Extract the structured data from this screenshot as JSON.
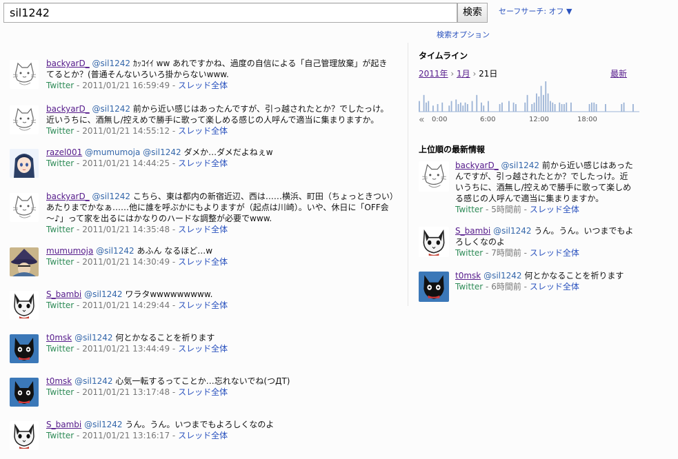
{
  "search": {
    "query": "sil1242",
    "button": "検索",
    "safe_search": "セーフサーチ: オフ ▼",
    "options": "検索オプション"
  },
  "results": [
    {
      "user": "backyarD_",
      "mention": "@sil1242",
      "text": "ｶｯｺｲｲ ww あれですかね、過度の自信による「自己管理放棄」が起きてるとか？(普通そんないろいろ掛からないwww.",
      "source": "Twitter",
      "time": "2011/01/21 16:59:49",
      "thread": "スレッド全体",
      "avatar": "cat-sketch"
    },
    {
      "user": "backyarD_",
      "mention": "@sil1242",
      "text": "前から近い感じはあったんですが、引っ越されたとか？でしたっけ。近いうちに、酒無し/控えめで勝手に歌って楽しめる感じの人呼んで適当に集まりますか。",
      "source": "Twitter",
      "time": "2011/01/21 14:55:12",
      "thread": "スレッド全体",
      "avatar": "cat-sketch"
    },
    {
      "user": "razel001",
      "mention": "@mumumoja @sil1242",
      "text": "ダメか…ダメだよねぇw",
      "source": "Twitter",
      "time": "2011/01/21 14:44:25",
      "thread": "スレッド全体",
      "avatar": "anime-girl"
    },
    {
      "user": "backyarD_",
      "mention": "@sil1242",
      "text": "こちら、東は都内の新宿近辺、西は……横浜、町田（ちょっときつい）あたりまでかなぁ……他に誰を呼ぶかにもよりますが（起点は川崎）。いや、休日に「OFF会～♪」って家を出るにはかなりのハードな調整が必要でwww.",
      "source": "Twitter",
      "time": "2011/01/21 14:35:48",
      "thread": "スレッド全体",
      "avatar": "cat-sketch"
    },
    {
      "user": "mumumoja",
      "mention": "@sil1242",
      "text": "あふん なるほど…w",
      "source": "Twitter",
      "time": "2011/01/21 14:30:49",
      "thread": "スレッド全体",
      "avatar": "wizard"
    },
    {
      "user": "S_bambi",
      "mention": "@sil1242",
      "text": "ワラタwwwwwwwww.",
      "source": "Twitter",
      "time": "2011/01/21 14:29:44",
      "thread": "スレッド全体",
      "avatar": "bw-cat"
    },
    {
      "user": "t0msk",
      "mention": "@sil1242",
      "text": "何とかなることを祈ります",
      "source": "Twitter",
      "time": "2011/01/21 13:44:49",
      "thread": "スレッド全体",
      "avatar": "black-cat"
    },
    {
      "user": "t0msk",
      "mention": "@sil1242",
      "text": "心気一転するってことか…忘れないでね(つДT)",
      "source": "Twitter",
      "time": "2011/01/21 13:17:48",
      "thread": "スレッド全体",
      "avatar": "black-cat"
    },
    {
      "user": "S_bambi",
      "mention": "@sil1242",
      "text": "うん。うん。いつまでもよろしくなのよ",
      "source": "Twitter",
      "time": "2011/01/21 13:16:17",
      "thread": "スレッド全体",
      "avatar": "bw-cat"
    }
  ],
  "timeline": {
    "title": "タイムライン",
    "year": "2011年",
    "month": "1月",
    "day": "21日",
    "sep": "›",
    "newest": "最新",
    "prev": "«",
    "hours": [
      "0:00",
      "6:00",
      "12:00",
      "18:00"
    ],
    "bars": [
      0.35,
      0.0,
      0.55,
      0.3,
      0.35,
      0.0,
      0.2,
      0.0,
      0.25,
      0.0,
      0.3,
      0.0,
      0.0,
      0.2,
      0.35,
      0.0,
      0.4,
      0.25,
      0.3,
      0.2,
      0.3,
      0.25,
      0.0,
      0.35,
      0.0,
      0.55,
      0.0,
      0.3,
      0.2,
      0.0,
      0.35,
      0.0,
      0.0,
      0.0,
      0.0,
      0.25,
      0.3,
      0.0,
      0.0,
      0.35,
      0.0,
      0.3,
      0.25,
      0.0,
      0.0,
      0.0,
      0.3,
      0.55,
      0.0,
      0.25,
      0.3,
      0.6,
      0.5,
      0.85,
      0.55,
      1.0,
      0.6,
      0.35,
      0.3,
      0.25,
      0.0,
      0.3,
      0.25,
      0.25,
      0.3,
      0.0,
      0.3,
      0.0,
      0.0,
      0.0,
      0.0,
      0.0,
      0.0,
      0.0,
      0.25,
      0.3,
      0.3,
      0.25,
      0.0,
      0.0,
      0.0,
      0.25,
      0.0,
      0.0,
      0.0,
      0.0,
      0.0,
      0.0,
      0.25,
      0.3,
      0.0,
      0.0,
      0.0,
      0.25,
      0.0,
      0.0
    ]
  },
  "top": {
    "title": "上位順の最新情報",
    "items": [
      {
        "user": "backyarD_",
        "mention": "@sil1242",
        "text": "前から近い感じはあったんですが、引っ越されたとか？でしたっけ。近いうちに、酒無し/控えめで勝手に歌って楽しめる感じの人呼んで適当に集まりますか。",
        "source": "Twitter",
        "time": "5時間前",
        "thread": "スレッド全体",
        "avatar": "cat-sketch"
      },
      {
        "user": "S_bambi",
        "mention": "@sil1242",
        "text": "うん。うん。いつまでもよろしくなのよ",
        "source": "Twitter",
        "time": "7時間前",
        "thread": "スレッド全体",
        "avatar": "bw-cat"
      },
      {
        "user": "t0msk",
        "mention": "@sil1242",
        "text": "何とかなることを祈ります",
        "source": "Twitter",
        "time": "6時間前",
        "thread": "スレッド全体",
        "avatar": "black-cat"
      }
    ]
  }
}
